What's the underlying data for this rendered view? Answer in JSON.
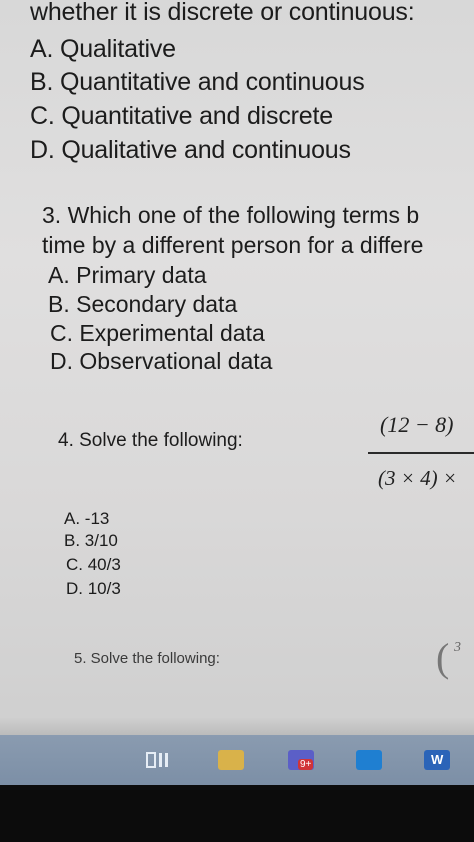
{
  "q2_tail": "whether it is discrete or continuous:",
  "q2_options": [
    "A. Qualitative",
    "B. Quantitative and continuous",
    "C. Quantitative and discrete",
    "D. Qualitative and continuous"
  ],
  "q3": {
    "line1": "3. Which one of the following terms b",
    "line2": "time by a different person for a differe",
    "options": [
      "A. Primary data",
      "B. Secondary data",
      "C. Experimental data",
      "D. Observational data"
    ]
  },
  "q4": {
    "prompt": "4. Solve the following:",
    "numerator": "(12 − 8)",
    "denominator": "(3 × 4) ×",
    "options": [
      "A. -13",
      "B. 3/10",
      "C. 40/3",
      "D. 10/3"
    ]
  },
  "q5": {
    "prompt": "5. Solve the following:",
    "fraction_top": "3"
  },
  "taskbar": {
    "badge": "9+",
    "icons": [
      "task-view-icon",
      "file-explorer-icon",
      "teams-icon",
      "outlook-icon",
      "word-icon"
    ]
  }
}
